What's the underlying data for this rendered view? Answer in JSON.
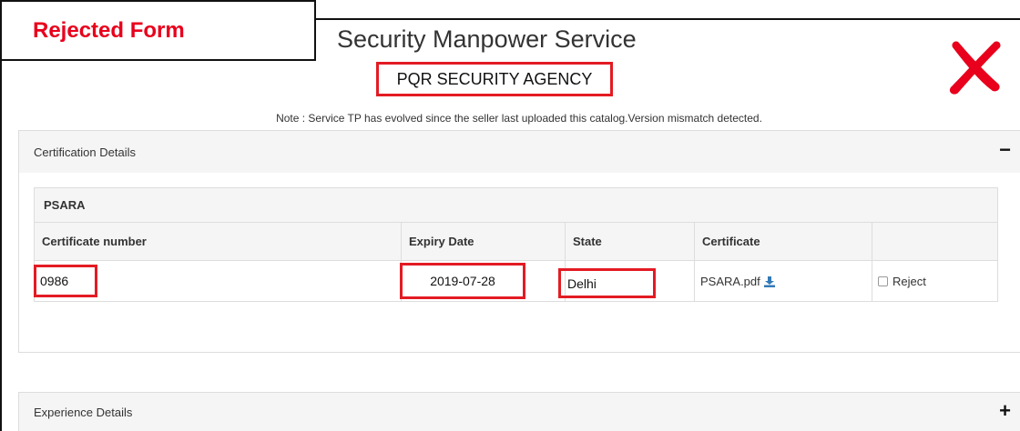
{
  "overlay": {
    "rejected_label": "Rejected Form"
  },
  "header": {
    "title": "Security Manpower Service",
    "agency": "PQR SECURITY AGENCY",
    "note": "Note : Service TP has evolved since the seller last uploaded this catalog.Version mismatch detected."
  },
  "certification": {
    "title": "Certification Details",
    "toggle": "−",
    "group_label": "PSARA",
    "columns": [
      "Certificate number",
      "Expiry Date",
      "State",
      "Certificate",
      ""
    ],
    "row": {
      "certificate_number": "0986",
      "expiry_date": "2019-07-28",
      "state": "Delhi",
      "certificate_file": "PSARA.pdf",
      "reject_label": "Reject"
    }
  },
  "experience": {
    "title": "Experience Details",
    "toggle": "+"
  },
  "colors": {
    "highlight": "#e31b23",
    "rejected_text": "#e8001c",
    "panel_bg": "#f5f5f5",
    "link_icon": "#337ab7"
  },
  "icons": {
    "reject_mark": "red-cross-icon",
    "download": "download-icon"
  }
}
